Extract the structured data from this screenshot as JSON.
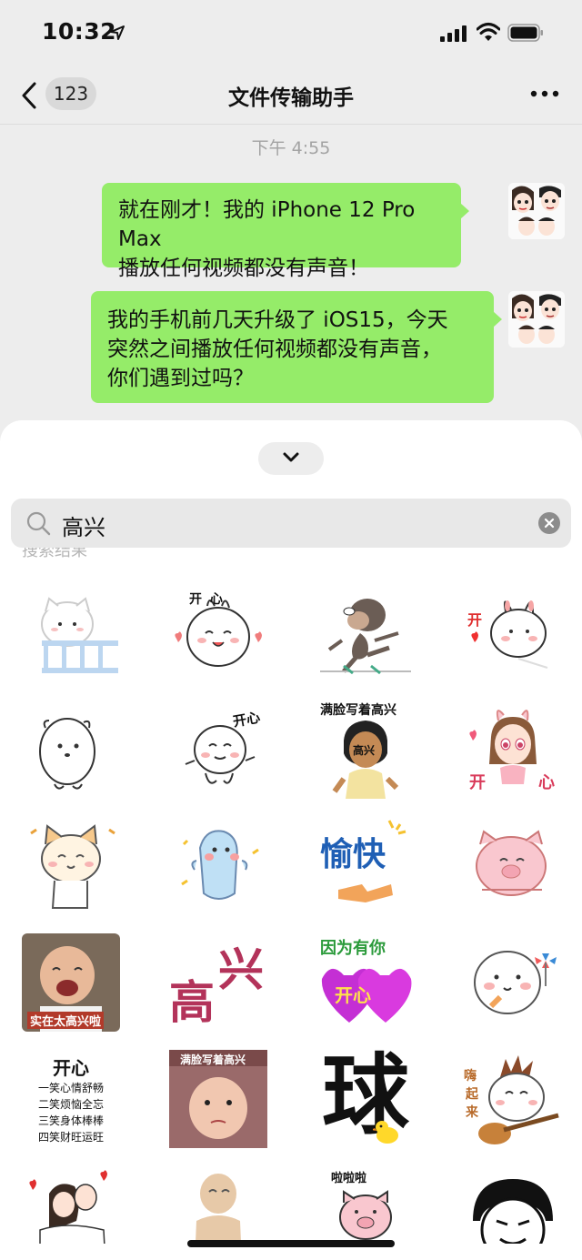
{
  "status_bar": {
    "time": "10:32"
  },
  "nav": {
    "back_count": "123",
    "title": "文件传输助手"
  },
  "chat": {
    "timestamp": "下午 4:55",
    "messages": [
      {
        "line1": "就在刚才！我的 iPhone 12 Pro Max",
        "line2": "播放任何视频都没有声音！"
      },
      {
        "line1": "我的手机前几天升级了 iOS15，今天",
        "line2": "突然之间播放任何视频都没有声音，",
        "line3": "你们遇到过吗？"
      }
    ]
  },
  "search": {
    "value": "高兴",
    "results_label": "搜索结果"
  },
  "stickers": {
    "open_heart": "开 心",
    "open_heart_2": "开心",
    "manlian": "满脸写着高兴",
    "gaoxing": "高兴",
    "kai": "开",
    "xin": "心",
    "yukuai": "愉快",
    "shizai": "实在太高兴啦",
    "gao": "高",
    "xing": "兴",
    "yinwei": "因为有你",
    "kaixin": "开心",
    "poem_title": "开心",
    "poem": [
      "一笑心情舒畅",
      "二笑烦恼全忘",
      "三笑身体棒棒",
      "四笑财旺运旺"
    ],
    "qiu": "球",
    "nao": "嗨",
    "qi": "起",
    "lai": "来",
    "lalala": "啦啦啦"
  },
  "colors": {
    "bubble": "#95ec69",
    "background": "#ededed",
    "panel": "#ffffff"
  }
}
